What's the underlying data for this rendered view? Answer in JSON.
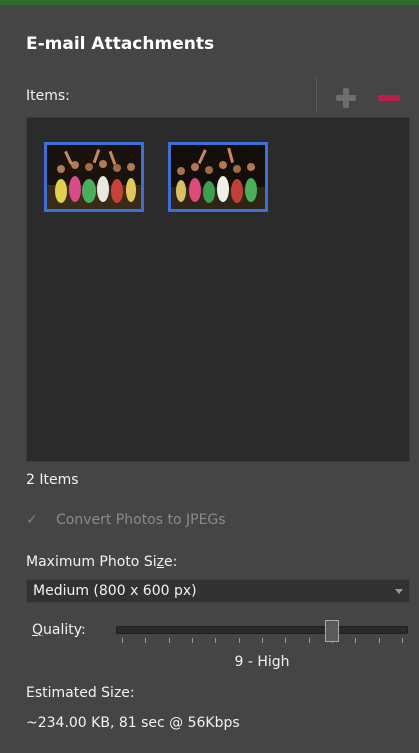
{
  "panel": {
    "title": "E-mail Attachments"
  },
  "items": {
    "label": "Items:",
    "count_text": "2 Items",
    "add_icon": "plus-icon",
    "remove_icon": "minus-icon",
    "thumbnails": [
      {
        "name": "photo-1",
        "accent": "#3d6fd6"
      },
      {
        "name": "photo-2",
        "accent": "#3d6fd6"
      }
    ]
  },
  "convert": {
    "label": "Convert Photos to JPEGs",
    "checked": true,
    "enabled": false
  },
  "max_size": {
    "label_before": "Maximum Photo Si",
    "label_mnemonic": "z",
    "label_after": "e:",
    "selected": "Medium (800 x 600 px)"
  },
  "quality": {
    "label_mnemonic": "Q",
    "label_rest": "uality:",
    "value_text": "9 - High",
    "value": 9,
    "min": 0,
    "max": 12
  },
  "estimate": {
    "label": "Estimated Size:",
    "value": "~234.00 KB, 81 sec @ 56Kbps"
  },
  "colors": {
    "panel_bg": "#454545",
    "items_bg": "#2b2b2b",
    "selection_border": "#3d6fd6",
    "remove_red": "#b9204a"
  }
}
